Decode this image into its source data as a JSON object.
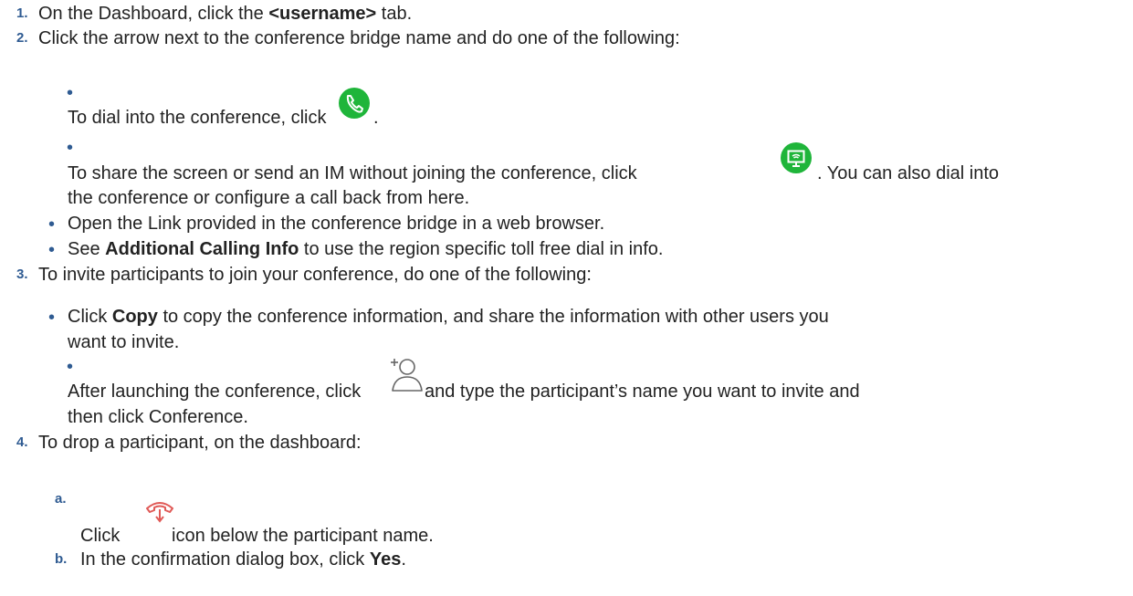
{
  "accent_color": "#2f5b92",
  "steps": [
    {
      "number": "1.",
      "segments": [
        "On the Dashboard, click the ",
        "<username>",
        " tab."
      ]
    },
    {
      "number": "2.",
      "text": "Click the arrow next to the conference bridge name and do one of the following:",
      "bullets": [
        {
          "before": "To dial into the conference, click ",
          "after": ".",
          "icon": "phone-call-icon"
        },
        {
          "before": "To share the screen or send an IM without joining the conference, click ",
          "after": ". You can also dial into",
          "line2": "the conference or configure a call back from here.",
          "icon": "screen-share-icon"
        },
        {
          "text": "Open the Link provided in the conference bridge in a web browser."
        },
        {
          "segments": [
            "See ",
            "Additional Calling Info",
            " to use the region specific toll free dial in info."
          ]
        }
      ]
    },
    {
      "number": "3.",
      "text": "To invite participants to join your conference, do one of the following:",
      "bullets": [
        {
          "segments": [
            "Click ",
            "Copy",
            " to copy the conference information, and share the information with other users you"
          ],
          "line2": "want to invite."
        },
        {
          "before": "After launching the conference, click ",
          "after": " and type the participant’s name you want to invite and",
          "line2": "then click Conference.",
          "icon": "add-participant-icon"
        }
      ]
    },
    {
      "number": "4.",
      "text": "To drop a participant, on the dashboard:",
      "substeps": [
        {
          "letter": "a.",
          "before": "Click ",
          "after": " icon below the participant name.",
          "icon": "drop-call-icon"
        },
        {
          "letter": "b.",
          "segments": [
            "In the confirmation dialog box, click ",
            "Yes",
            "."
          ]
        }
      ]
    }
  ]
}
